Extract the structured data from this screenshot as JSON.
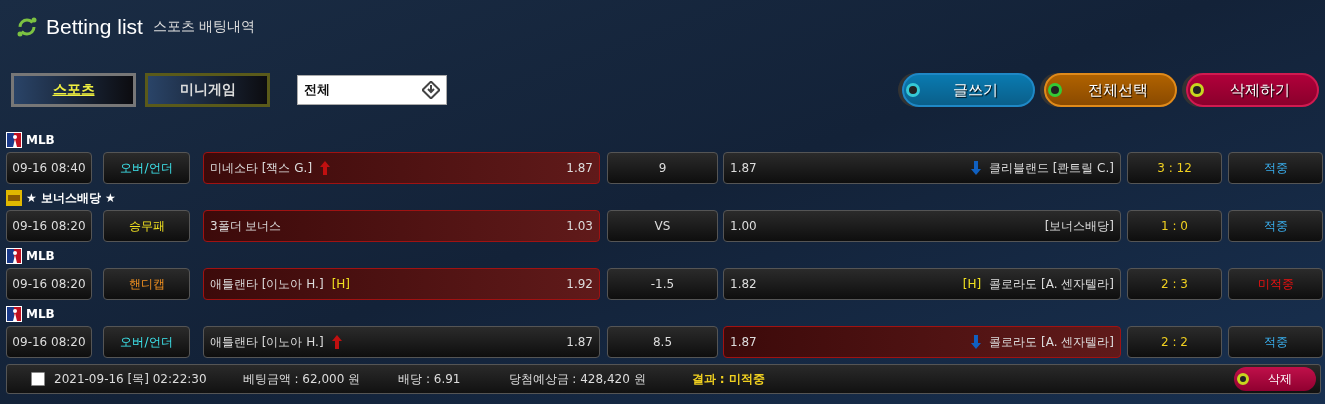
{
  "header": {
    "title": "Betting list",
    "subtitle": "스포츠 배팅내역"
  },
  "tabs": [
    {
      "label": "스포츠",
      "selected": true
    },
    {
      "label": "미니게임",
      "selected": false
    }
  ],
  "filter": {
    "value": "전체"
  },
  "actions": [
    {
      "label": "글쓰기",
      "kind": "write"
    },
    {
      "label": "전체선택",
      "kind": "select_all"
    },
    {
      "label": "삭제하기",
      "kind": "delete"
    }
  ],
  "rows": [
    {
      "league": {
        "kind": "mlb",
        "name": "MLB"
      },
      "time": "09-16 08:40",
      "bet_type": {
        "label": "오버/언더",
        "kind": "over_under"
      },
      "home": {
        "team": "미네소타 [잭스 G.]",
        "arrow_up": true,
        "odds": "1.87",
        "selected": true
      },
      "center": "9",
      "away": {
        "odds": "1.87",
        "arrow_down": true,
        "team": "클리블랜드 [콴트릴 C.]",
        "selected": false
      },
      "score": "3 : 12",
      "result": {
        "label": "적중",
        "kind": "hit"
      }
    },
    {
      "league": {
        "kind": "bonus",
        "name": "★ 보너스배당 ★"
      },
      "time": "09-16 08:20",
      "bet_type": {
        "label": "승무패",
        "kind": "win_lose"
      },
      "home": {
        "team": "3폴더 보너스",
        "arrow_up": false,
        "odds": "1.03",
        "selected": true
      },
      "center": "VS",
      "away": {
        "odds": "1.00",
        "arrow_down": false,
        "team": "[보너스배당]",
        "selected": false
      },
      "score": "1 : 0",
      "result": {
        "label": "적중",
        "kind": "hit"
      }
    },
    {
      "league": {
        "kind": "mlb",
        "name": "MLB"
      },
      "time": "09-16 08:20",
      "bet_type": {
        "label": "핸디캡",
        "kind": "handicap"
      },
      "home": {
        "team": "애틀랜타 [이노아 H.]",
        "tag": "[H]",
        "arrow_up": false,
        "odds": "1.92",
        "selected": true
      },
      "center": "-1.5",
      "away": {
        "odds": "1.82",
        "arrow_down": false,
        "tag": "[H]",
        "team": "콜로라도 [A. 센자텔라]",
        "selected": false
      },
      "score": "2 : 3",
      "result": {
        "label": "미적중",
        "kind": "miss"
      }
    },
    {
      "league": {
        "kind": "mlb",
        "name": "MLB"
      },
      "time": "09-16 08:20",
      "bet_type": {
        "label": "오버/언더",
        "kind": "over_under"
      },
      "home": {
        "team": "애틀랜타 [이노아 H.]",
        "arrow_up": true,
        "odds": "1.87",
        "selected": false
      },
      "center": "8.5",
      "away": {
        "odds": "1.87",
        "arrow_down": true,
        "team": "콜로라도 [A. 센자텔라]",
        "selected": true
      },
      "score": "2 : 2",
      "result": {
        "label": "적중",
        "kind": "hit"
      }
    }
  ],
  "footer": {
    "checked": false,
    "datetime": "2021-09-16 [목] 02:22:30",
    "amount": "베팅금액 : 62,000 원",
    "odds": "배당 : 6.91",
    "expected": "당첨예상금 : 428,420 원",
    "result": "결과 : 미적중",
    "delete_label": "삭제"
  }
}
